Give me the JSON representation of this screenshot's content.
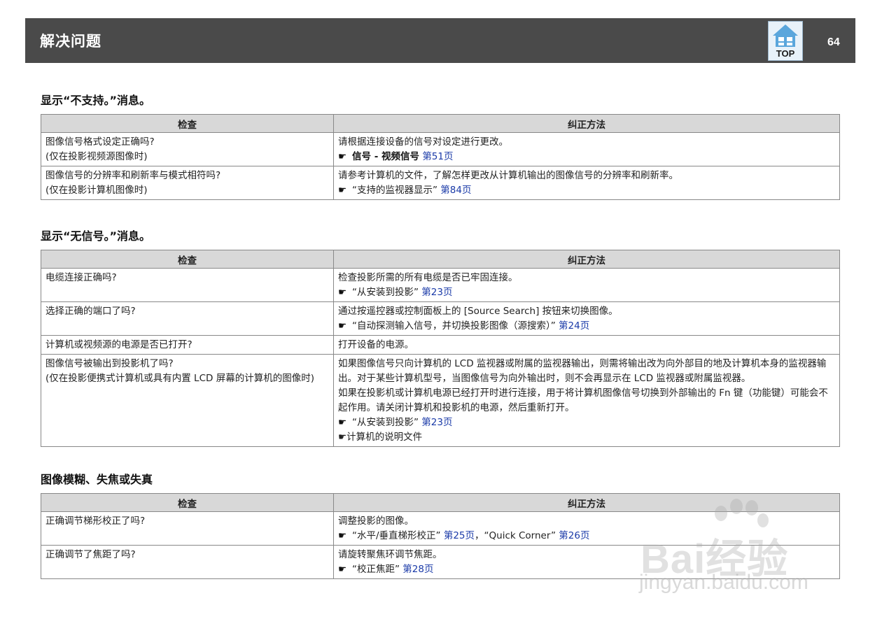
{
  "header": {
    "title": "解决问题",
    "top_label": "TOP",
    "page_number": "64"
  },
  "columns": {
    "check": "检查",
    "fix": "纠正方法"
  },
  "sections": [
    {
      "title": "显示“不支持。”消息。",
      "rows": [
        {
          "check": [
            "图像信号格式设定正确吗?",
            "(仅在投影视频源图像时)"
          ],
          "fix_text": "请根据连接设备的信号对设定进行更改。",
          "ref_text": "信号 - 视频信号",
          "ref_page": "第51页"
        },
        {
          "check": [
            "图像信号的分辨率和刷新率与模式相符吗?",
            "(仅在投影计算机图像时)"
          ],
          "fix_text": "请参考计算机的文件，了解怎样更改从计算机输出的图像信号的分辨率和刷新率。",
          "ref_text": "“支持的监视器显示”",
          "ref_page": "第84页"
        }
      ]
    },
    {
      "title": "显示“无信号。”消息。",
      "rows": [
        {
          "check": [
            "电缆连接正确吗?"
          ],
          "fix_text": "检查投影所需的所有电缆是否已牢固连接。",
          "ref_text": "“从安装到投影”",
          "ref_page": "第23页"
        },
        {
          "check": [
            "选择正确的端口了吗?"
          ],
          "fix_text": "通过按遥控器或控制面板上的 [Source Search] 按钮来切换图像。",
          "ref_text": "“自动探测输入信号，并切换投影图像（源搜索）”",
          "ref_page": "第24页"
        },
        {
          "check": [
            "计算机或视频源的电源是否已打开?"
          ],
          "fix_text": "打开设备的电源。"
        },
        {
          "check": [
            "图像信号被输出到投影机了吗?",
            "(仅在投影便携式计算机或具有内置 LCD 屏幕的计算机的图像时)"
          ],
          "fix_p1": "如果图像信号只向计算机的 LCD 监视器或附属的监视器输出，则需将输出改为向外部目的地及计算机本身的监视器输出。对于某些计算机型号，当图像信号为向外输出时，则不会再显示在 LCD 监视器或附属监视器。",
          "fix_p2": "如果在投影机或计算机电源已经打开时进行连接，用于将计算机图像信号切换到外部输出的 Fn 键（功能键）可能会不起作用。请关闭计算机和投影机的电源，然后重新打开。",
          "ref_text": "“从安装到投影”",
          "ref_page": "第23页",
          "ref2_text": "计算机的说明文件"
        }
      ]
    },
    {
      "title": "图像模糊、失焦或失真",
      "rows": [
        {
          "check": [
            "正确调节梯形校正了吗?"
          ],
          "fix_text": "调整投影的图像。",
          "ref_text": "“水平/垂直梯形校正”",
          "ref_page": "第25页",
          "ref_sep": "，",
          "ref_b_text": "“Quick Corner”",
          "ref_b_page": "第26页"
        },
        {
          "check": [
            "正确调节了焦距了吗?"
          ],
          "fix_text": "请旋转聚焦环调节焦距。",
          "ref_text": "“校正焦距”",
          "ref_page": "第28页"
        }
      ]
    }
  ],
  "symbols": {
    "hand": "☛"
  },
  "watermark": {
    "line1": "Bai经验",
    "line2": "jingyan.baidu.com"
  }
}
